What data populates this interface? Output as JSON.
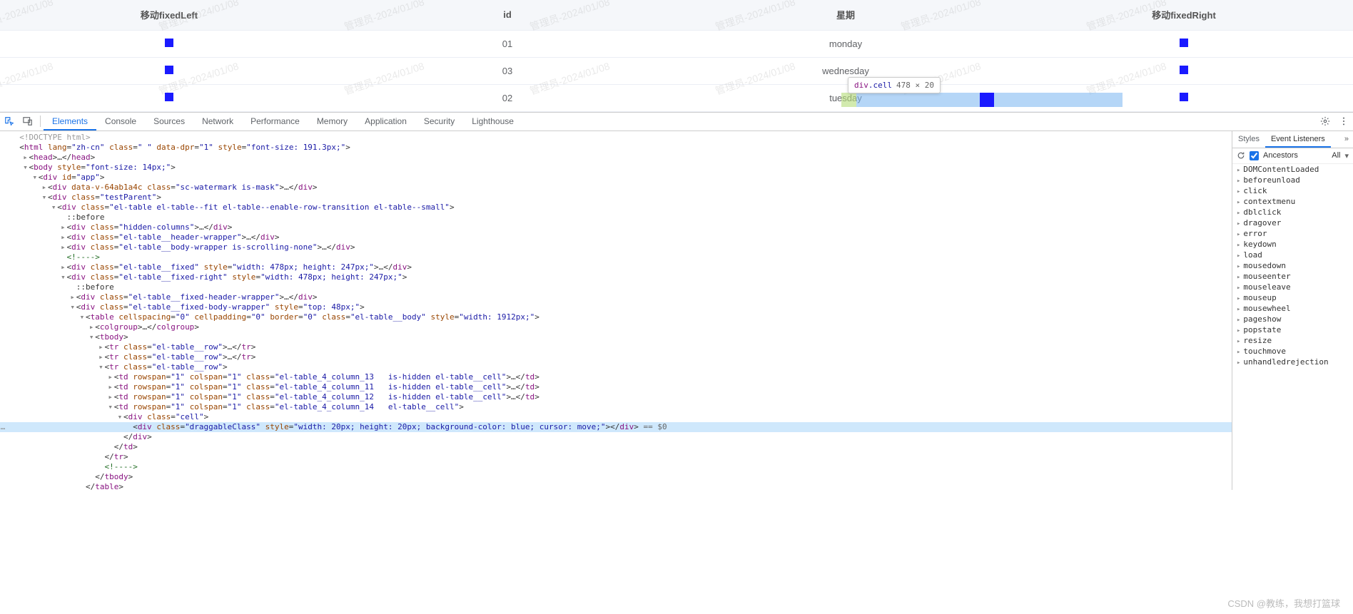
{
  "watermark_text": "管理员-2024/01/08",
  "table": {
    "headers": [
      "移动fixedLeft",
      "id",
      "星期",
      "移动fixedRight"
    ],
    "rows": [
      {
        "id": "01",
        "week": "monday"
      },
      {
        "id": "03",
        "week": "wednesday"
      },
      {
        "id": "02",
        "week": "tuesday"
      }
    ]
  },
  "inspect_tooltip": {
    "selector": "div",
    "class": ".cell",
    "dimensions": "478 × 20"
  },
  "devtools": {
    "tabs": [
      "Elements",
      "Console",
      "Sources",
      "Network",
      "Performance",
      "Memory",
      "Application",
      "Security",
      "Lighthouse"
    ],
    "active_tab": "Elements",
    "sidebar": {
      "tabs": [
        "Styles",
        "Event Listeners"
      ],
      "active_tab": "Event Listeners",
      "ancestors_label": "Ancestors",
      "all_label": "All",
      "ancestors_checked": true,
      "events": [
        "DOMContentLoaded",
        "beforeunload",
        "click",
        "contextmenu",
        "dblclick",
        "dragover",
        "error",
        "keydown",
        "load",
        "mousedown",
        "mouseenter",
        "mouseleave",
        "mouseup",
        "mousewheel",
        "pageshow",
        "popstate",
        "resize",
        "touchmove",
        "unhandledrejection"
      ]
    },
    "dom_lines": [
      {
        "indent": 0,
        "arrow": "",
        "html": "<span class='t-doctype'>&lt;!DOCTYPE html&gt;</span>"
      },
      {
        "indent": 0,
        "arrow": "",
        "html": "<span class='t-punct'>&lt;</span><span class='t-tag'>html</span> <span class='t-attr'>lang</span>=<span class='t-val'>\"zh-cn\"</span> <span class='t-attr'>class</span>=<span class='t-val'>\" \"</span> <span class='t-attr'>data-dpr</span>=<span class='t-val'>\"1\"</span> <span class='t-attr'>style</span>=<span class='t-val'>\"font-size: 191.3px;\"</span><span class='t-punct'>&gt;</span>"
      },
      {
        "indent": 1,
        "arrow": "▸",
        "html": "<span class='t-punct'>&lt;</span><span class='t-tag'>head</span><span class='t-punct'>&gt;…&lt;/</span><span class='t-tag'>head</span><span class='t-punct'>&gt;</span>"
      },
      {
        "indent": 1,
        "arrow": "▾",
        "html": "<span class='t-punct'>&lt;</span><span class='t-tag'>body</span> <span class='t-attr'>style</span>=<span class='t-val'>\"font-size: 14px;\"</span><span class='t-punct'>&gt;</span>"
      },
      {
        "indent": 2,
        "arrow": "▾",
        "html": "<span class='t-punct'>&lt;</span><span class='t-tag'>div</span> <span class='t-attr'>id</span>=<span class='t-val'>\"app\"</span><span class='t-punct'>&gt;</span>"
      },
      {
        "indent": 3,
        "arrow": "▸",
        "html": "<span class='t-punct'>&lt;</span><span class='t-tag'>div</span> <span class='t-attr'>data-v-64ab1a4c</span> <span class='t-attr'>class</span>=<span class='t-val'>\"sc-watermark is-mask\"</span><span class='t-punct'>&gt;…&lt;/</span><span class='t-tag'>div</span><span class='t-punct'>&gt;</span>"
      },
      {
        "indent": 3,
        "arrow": "▾",
        "html": "<span class='t-punct'>&lt;</span><span class='t-tag'>div</span> <span class='t-attr'>class</span>=<span class='t-val'>\"testParent\"</span><span class='t-punct'>&gt;</span>"
      },
      {
        "indent": 4,
        "arrow": "▾",
        "html": "<span class='t-punct'>&lt;</span><span class='t-tag'>div</span> <span class='t-attr'>class</span>=<span class='t-val'>\"el-table el-table--fit el-table--enable-row-transition el-table--small\"</span><span class='t-punct'>&gt;</span>"
      },
      {
        "indent": 5,
        "arrow": "",
        "html": "<span class='t-punct'>::before</span>"
      },
      {
        "indent": 5,
        "arrow": "▸",
        "html": "<span class='t-punct'>&lt;</span><span class='t-tag'>div</span> <span class='t-attr'>class</span>=<span class='t-val'>\"hidden-columns\"</span><span class='t-punct'>&gt;…&lt;/</span><span class='t-tag'>div</span><span class='t-punct'>&gt;</span>"
      },
      {
        "indent": 5,
        "arrow": "▸",
        "html": "<span class='t-punct'>&lt;</span><span class='t-tag'>div</span> <span class='t-attr'>class</span>=<span class='t-val'>\"el-table__header-wrapper\"</span><span class='t-punct'>&gt;…&lt;/</span><span class='t-tag'>div</span><span class='t-punct'>&gt;</span>"
      },
      {
        "indent": 5,
        "arrow": "▸",
        "html": "<span class='t-punct'>&lt;</span><span class='t-tag'>div</span> <span class='t-attr'>class</span>=<span class='t-val'>\"el-table__body-wrapper is-scrolling-none\"</span><span class='t-punct'>&gt;…&lt;/</span><span class='t-tag'>div</span><span class='t-punct'>&gt;</span>"
      },
      {
        "indent": 5,
        "arrow": "",
        "html": "<span class='t-comment'>&lt;!----&gt;</span>"
      },
      {
        "indent": 5,
        "arrow": "▸",
        "html": "<span class='t-punct'>&lt;</span><span class='t-tag'>div</span> <span class='t-attr'>class</span>=<span class='t-val'>\"el-table__fixed\"</span> <span class='t-attr'>style</span>=<span class='t-val'>\"width: 478px; height: 247px;\"</span><span class='t-punct'>&gt;…&lt;/</span><span class='t-tag'>div</span><span class='t-punct'>&gt;</span>"
      },
      {
        "indent": 5,
        "arrow": "▾",
        "html": "<span class='t-punct'>&lt;</span><span class='t-tag'>div</span> <span class='t-attr'>class</span>=<span class='t-val'>\"el-table__fixed-right\"</span> <span class='t-attr'>style</span>=<span class='t-val'>\"width: 478px; height: 247px;\"</span><span class='t-punct'>&gt;</span>"
      },
      {
        "indent": 6,
        "arrow": "",
        "html": "<span class='t-punct'>::before</span>"
      },
      {
        "indent": 6,
        "arrow": "▸",
        "html": "<span class='t-punct'>&lt;</span><span class='t-tag'>div</span> <span class='t-attr'>class</span>=<span class='t-val'>\"el-table__fixed-header-wrapper\"</span><span class='t-punct'>&gt;…&lt;/</span><span class='t-tag'>div</span><span class='t-punct'>&gt;</span>"
      },
      {
        "indent": 6,
        "arrow": "▾",
        "html": "<span class='t-punct'>&lt;</span><span class='t-tag'>div</span> <span class='t-attr'>class</span>=<span class='t-val'>\"el-table__fixed-body-wrapper\"</span> <span class='t-attr'>style</span>=<span class='t-val'>\"top: 48px;\"</span><span class='t-punct'>&gt;</span>"
      },
      {
        "indent": 7,
        "arrow": "▾",
        "html": "<span class='t-punct'>&lt;</span><span class='t-tag'>table</span> <span class='t-attr'>cellspacing</span>=<span class='t-val'>\"0\"</span> <span class='t-attr'>cellpadding</span>=<span class='t-val'>\"0\"</span> <span class='t-attr'>border</span>=<span class='t-val'>\"0\"</span> <span class='t-attr'>class</span>=<span class='t-val'>\"el-table__body\"</span> <span class='t-attr'>style</span>=<span class='t-val'>\"width: 1912px;\"</span><span class='t-punct'>&gt;</span>"
      },
      {
        "indent": 8,
        "arrow": "▸",
        "html": "<span class='t-punct'>&lt;</span><span class='t-tag'>colgroup</span><span class='t-punct'>&gt;…&lt;/</span><span class='t-tag'>colgroup</span><span class='t-punct'>&gt;</span>"
      },
      {
        "indent": 8,
        "arrow": "▾",
        "html": "<span class='t-punct'>&lt;</span><span class='t-tag'>tbody</span><span class='t-punct'>&gt;</span>"
      },
      {
        "indent": 9,
        "arrow": "▸",
        "html": "<span class='t-punct'>&lt;</span><span class='t-tag'>tr</span> <span class='t-attr'>class</span>=<span class='t-val'>\"el-table__row\"</span><span class='t-punct'>&gt;…&lt;/</span><span class='t-tag'>tr</span><span class='t-punct'>&gt;</span>"
      },
      {
        "indent": 9,
        "arrow": "▸",
        "html": "<span class='t-punct'>&lt;</span><span class='t-tag'>tr</span> <span class='t-attr'>class</span>=<span class='t-val'>\"el-table__row\"</span><span class='t-punct'>&gt;…&lt;/</span><span class='t-tag'>tr</span><span class='t-punct'>&gt;</span>"
      },
      {
        "indent": 9,
        "arrow": "▾",
        "html": "<span class='t-punct'>&lt;</span><span class='t-tag'>tr</span> <span class='t-attr'>class</span>=<span class='t-val'>\"el-table__row\"</span><span class='t-punct'>&gt;</span>"
      },
      {
        "indent": 10,
        "arrow": "▸",
        "html": "<span class='t-punct'>&lt;</span><span class='t-tag'>td</span> <span class='t-attr'>rowspan</span>=<span class='t-val'>\"1\"</span> <span class='t-attr'>colspan</span>=<span class='t-val'>\"1\"</span> <span class='t-attr'>class</span>=<span class='t-val'>\"el-table_4_column_13   is-hidden el-table__cell\"</span><span class='t-punct'>&gt;…&lt;/</span><span class='t-tag'>td</span><span class='t-punct'>&gt;</span>"
      },
      {
        "indent": 10,
        "arrow": "▸",
        "html": "<span class='t-punct'>&lt;</span><span class='t-tag'>td</span> <span class='t-attr'>rowspan</span>=<span class='t-val'>\"1\"</span> <span class='t-attr'>colspan</span>=<span class='t-val'>\"1\"</span> <span class='t-attr'>class</span>=<span class='t-val'>\"el-table_4_column_11   is-hidden el-table__cell\"</span><span class='t-punct'>&gt;…&lt;/</span><span class='t-tag'>td</span><span class='t-punct'>&gt;</span>"
      },
      {
        "indent": 10,
        "arrow": "▸",
        "html": "<span class='t-punct'>&lt;</span><span class='t-tag'>td</span> <span class='t-attr'>rowspan</span>=<span class='t-val'>\"1\"</span> <span class='t-attr'>colspan</span>=<span class='t-val'>\"1\"</span> <span class='t-attr'>class</span>=<span class='t-val'>\"el-table_4_column_12   is-hidden el-table__cell\"</span><span class='t-punct'>&gt;…&lt;/</span><span class='t-tag'>td</span><span class='t-punct'>&gt;</span>"
      },
      {
        "indent": 10,
        "arrow": "▾",
        "html": "<span class='t-punct'>&lt;</span><span class='t-tag'>td</span> <span class='t-attr'>rowspan</span>=<span class='t-val'>\"1\"</span> <span class='t-attr'>colspan</span>=<span class='t-val'>\"1\"</span> <span class='t-attr'>class</span>=<span class='t-val'>\"el-table_4_column_14   el-table__cell\"</span><span class='t-punct'>&gt;</span>"
      },
      {
        "indent": 11,
        "arrow": "▾",
        "html": "<span class='t-punct'>&lt;</span><span class='t-tag'>div</span> <span class='t-attr'>class</span>=<span class='t-val'>\"cell\"</span><span class='t-punct'>&gt;</span>"
      },
      {
        "indent": 12,
        "arrow": "",
        "sel": true,
        "dots": true,
        "html": "<span class='t-punct'>&lt;</span><span class='t-tag'>div</span> <span class='t-attr'>class</span>=<span class='t-val'>\"draggableClass\"</span> <span class='t-attr'>style</span>=<span class='t-val'>\"width: 20px; height: 20px; background-color: blue; cursor: move;\"</span><span class='t-punct'>&gt;&lt;/</span><span class='t-tag'>div</span><span class='t-punct'>&gt;</span> <span class='t-eq'>== $0</span>"
      },
      {
        "indent": 11,
        "arrow": "",
        "html": "<span class='t-punct'>&lt;/</span><span class='t-tag'>div</span><span class='t-punct'>&gt;</span>"
      },
      {
        "indent": 10,
        "arrow": "",
        "html": "<span class='t-punct'>&lt;/</span><span class='t-tag'>td</span><span class='t-punct'>&gt;</span>"
      },
      {
        "indent": 9,
        "arrow": "",
        "html": "<span class='t-punct'>&lt;/</span><span class='t-tag'>tr</span><span class='t-punct'>&gt;</span>"
      },
      {
        "indent": 9,
        "arrow": "",
        "html": "<span class='t-comment'>&lt;!----&gt;</span>"
      },
      {
        "indent": 8,
        "arrow": "",
        "html": "<span class='t-punct'>&lt;/</span><span class='t-tag'>tbody</span><span class='t-punct'>&gt;</span>"
      },
      {
        "indent": 7,
        "arrow": "",
        "html": "<span class='t-punct'>&lt;/</span><span class='t-tag'>table</span><span class='t-punct'>&gt;</span>"
      }
    ]
  },
  "csdn": "CSDN @教练，我想打篮球"
}
